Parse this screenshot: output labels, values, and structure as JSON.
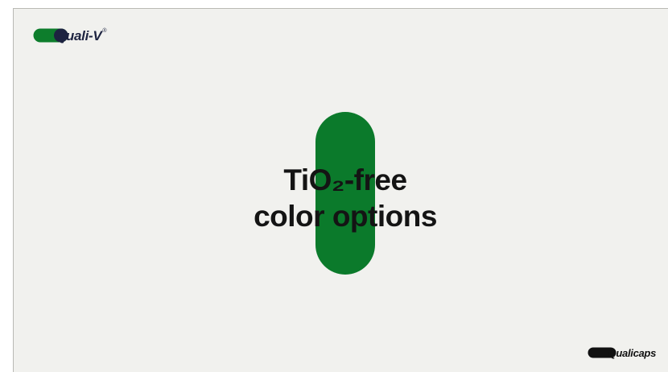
{
  "header": {
    "brand_name": "Quali-V",
    "brand_mark": "®"
  },
  "main": {
    "headline_line1": "TiO₂-free",
    "headline_line2": "color options",
    "capsule_icon": "capsule-icon"
  },
  "footer": {
    "company_name": "Qualicaps"
  },
  "colors": {
    "background": "#f1f1ee",
    "capsule_green": "#0b7a2b",
    "brand_navy": "#1d2340",
    "brand_green": "#0d7d2c",
    "text": "#141414"
  }
}
